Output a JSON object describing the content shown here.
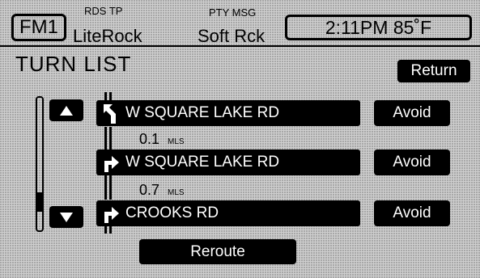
{
  "header": {
    "source": "FM1",
    "rds_label": "RDS TP",
    "station": "LiteRock",
    "pty_label": "PTY MSG",
    "genre": "Soft Rck",
    "clock": "2:11PM 85˚F"
  },
  "page": {
    "title": "TURN LIST",
    "return_label": "Return",
    "reroute_label": "Reroute"
  },
  "turns": [
    {
      "icon": "turn-slight-left-icon",
      "street": "W SQUARE LAKE RD",
      "avoid_label": "Avoid",
      "distance": "0.1",
      "unit": "MLS"
    },
    {
      "icon": "turn-right-icon",
      "street": "W SQUARE LAKE RD",
      "avoid_label": "Avoid",
      "distance": "0.7",
      "unit": "MLS"
    },
    {
      "icon": "turn-right-icon",
      "street": "CROOKS RD",
      "avoid_label": "Avoid"
    }
  ],
  "scroll": {
    "position_fraction": 0.78
  }
}
